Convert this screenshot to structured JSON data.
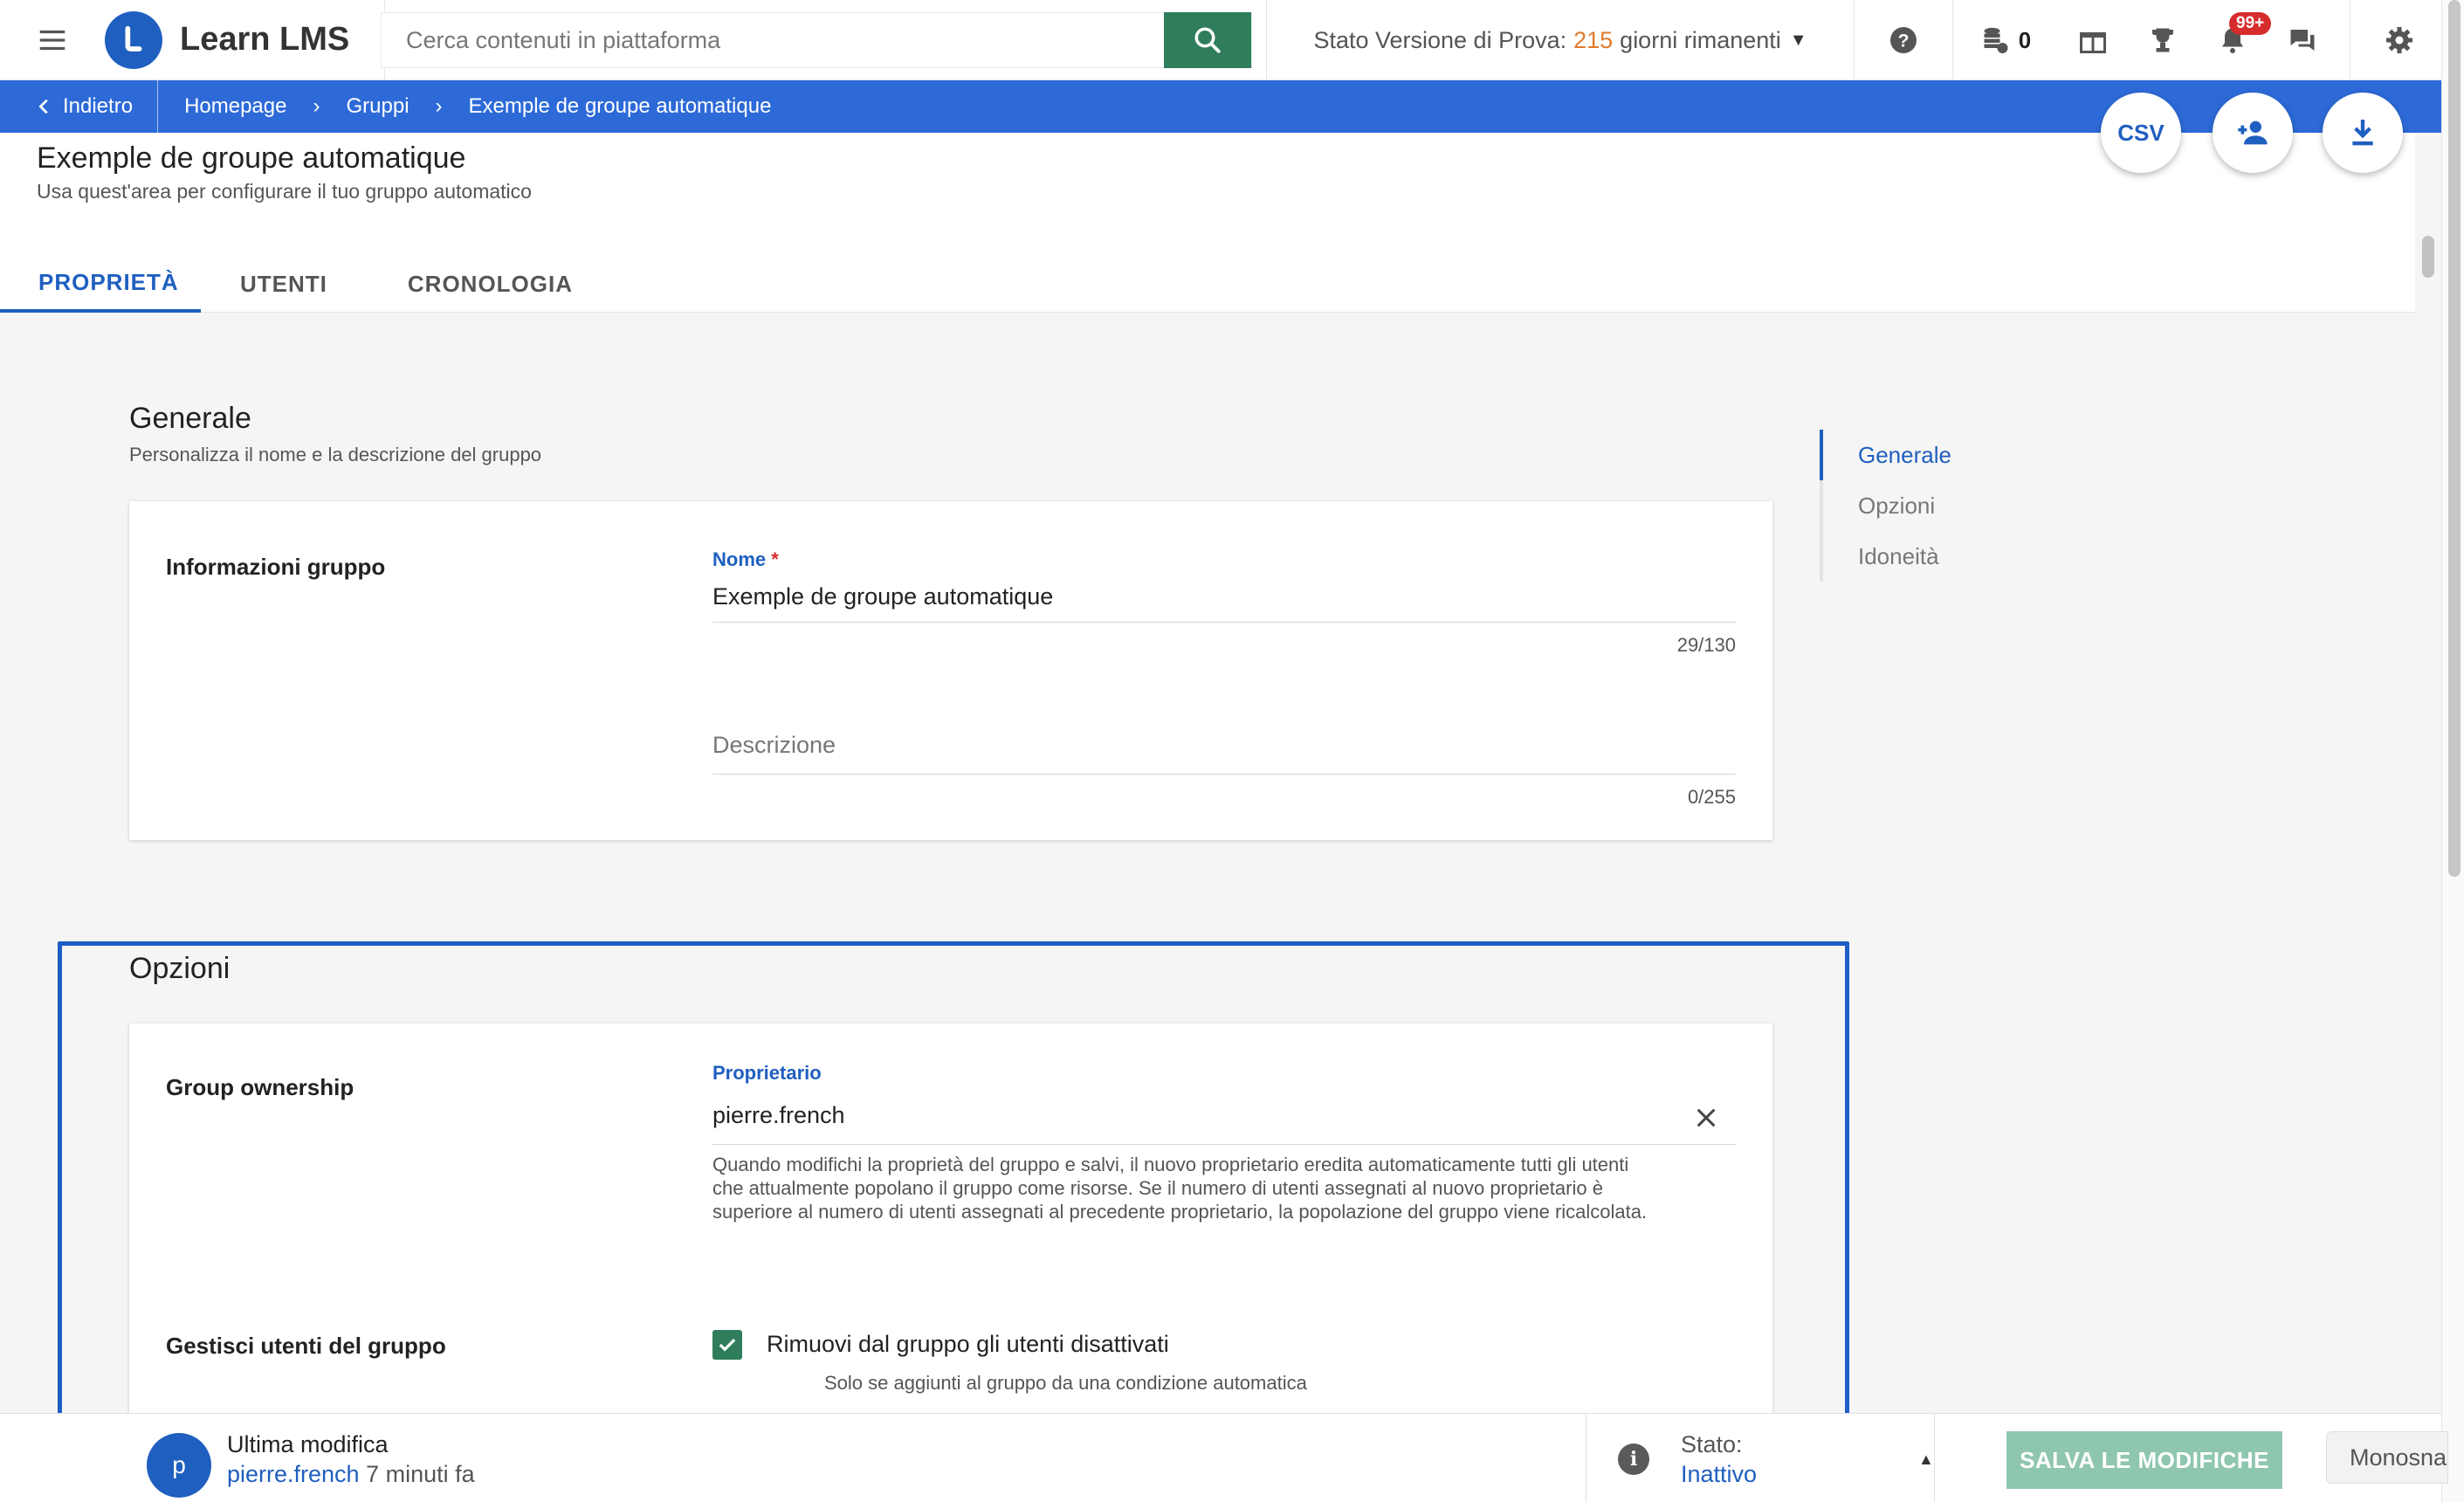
{
  "app": {
    "name": "Learn LMS"
  },
  "search": {
    "placeholder": "Cerca contenuti in piattaforma"
  },
  "trial": {
    "prefix": "Stato Versione di Prova:",
    "days": "215",
    "suffix": "giorni rimanenti"
  },
  "topbar": {
    "coins_count": "0",
    "notifications_badge": "99+"
  },
  "breadcrumb": {
    "back_label": "Indietro",
    "items": [
      "Homepage",
      "Gruppi",
      "Exemple de groupe automatique"
    ]
  },
  "actions": {
    "csv_label": "CSV"
  },
  "page": {
    "title": "Exemple de groupe automatique",
    "subtitle": "Usa quest'area per configurare il tuo gruppo automatico"
  },
  "tabs": [
    {
      "label": "PROPRIETÀ"
    },
    {
      "label": "UTENTI"
    },
    {
      "label": "CRONOLOGIA"
    }
  ],
  "general": {
    "title": "Generale",
    "subtitle": "Personalizza il nome e la descrizione del gruppo",
    "row_label": "Informazioni gruppo",
    "name_label": "Nome",
    "name_required": "*",
    "name_value": "Exemple de groupe automatique",
    "name_counter": "29/130",
    "description_placeholder": "Descrizione",
    "description_counter": "0/255"
  },
  "options": {
    "title": "Opzioni",
    "ownership_label": "Group ownership",
    "owner_field_label": "Proprietario",
    "owner_value": "pierre.french",
    "owner_help_lines": [
      "Quando modifichi la proprietà del gruppo e salvi, il nuovo proprietario eredita automaticamente tutti gli utenti",
      "che attualmente popolano il gruppo come risorse. Se il numero di utenti assegnati al nuovo proprietario è",
      "superiore al numero di utenti assegnati al precedente proprietario, la popolazione del gruppo viene ricalcolata."
    ],
    "manage_label": "Gestisci utenti del gruppo",
    "remove_checkbox_label": "Rimuovi dal gruppo gli utenti disattivati",
    "remove_checkbox_checked": true,
    "remove_checkbox_hint": "Solo se aggiunti al gruppo da una condizione automatica"
  },
  "section_nav": [
    {
      "label": "Generale",
      "active": true
    },
    {
      "label": "Opzioni"
    },
    {
      "label": "Idoneità"
    }
  ],
  "footer": {
    "avatar_initial": "p",
    "last_modified_title": "Ultima modifica",
    "last_modified_user": "pierre.french",
    "last_modified_time": "7 minuti fa",
    "status_label": "Stato:",
    "status_value": "Inattivo",
    "save_label": "SALVA LE MODIFICHE",
    "monosnap_label": "Monosnap"
  },
  "colors": {
    "brand_blue": "#1f5fbf",
    "breadcrumb_blue": "#2d6ad8",
    "search_green": "#2f7d5b",
    "save_disabled": "#8fc6b0",
    "badge_red": "#d72c2c",
    "trial_orange": "#e07b2c"
  }
}
